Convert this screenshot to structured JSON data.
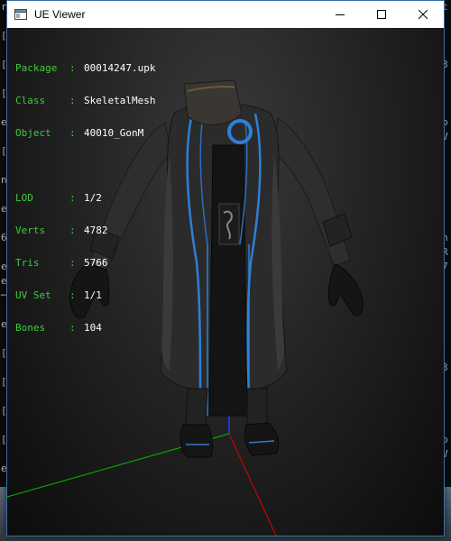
{
  "window": {
    "title": "UE Viewer"
  },
  "info": {
    "package": {
      "key": "Package",
      "sep": ":",
      "value": "00014247.upk"
    },
    "class": {
      "key": "Class",
      "sep": ":",
      "value": "SkeletalMesh"
    },
    "object": {
      "key": "Object",
      "sep": ":",
      "value": "40010_GonM"
    },
    "lod": {
      "key": "LOD",
      "sep": ":",
      "value": "1/2"
    },
    "verts": {
      "key": "Verts",
      "sep": ":",
      "value": "4782"
    },
    "tris": {
      "key": "Tris",
      "sep": ":",
      "value": "5766"
    },
    "uvset": {
      "key": "UV Set",
      "sep": ":",
      "value": "1/1"
    },
    "bones": {
      "key": "Bones",
      "sep": ":",
      "value": "104"
    }
  },
  "colors": {
    "label": "#3ecb3e",
    "value": "#ffffff",
    "axis_x": "#e00000",
    "axis_y": "#00c000",
    "axis_z": "#1e3cff",
    "trim": "#2f7fd6"
  },
  "icons": [
    "app-window-icon",
    "minimize-icon",
    "maximize-icon",
    "close-icon"
  ],
  "background": {
    "left_chars": [
      "r",
      "",
      "[",
      "",
      "[",
      "",
      "[",
      "",
      "e",
      "",
      "[",
      "",
      "n",
      "",
      "e",
      "",
      "6",
      "",
      "e",
      "e",
      "─",
      "",
      "e",
      "",
      "[",
      "",
      "[",
      "",
      "[",
      "",
      "[",
      "",
      "e",
      "",
      "e",
      "[",
      ""
    ],
    "right_chars": [
      "t",
      "",
      "",
      "",
      "3",
      "",
      "",
      "",
      "o",
      "V",
      "",
      "",
      "",
      "",
      "",
      "",
      "n",
      "R",
      "7",
      "",
      "",
      "",
      "",
      "",
      "",
      "3",
      "",
      "",
      "",
      "",
      "o",
      "V"
    ]
  }
}
